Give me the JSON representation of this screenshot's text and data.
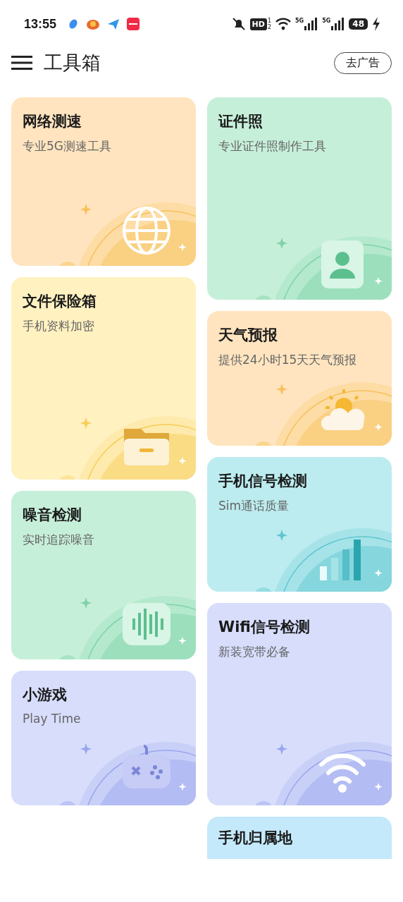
{
  "status_bar": {
    "time": "13:55",
    "hd": "HD",
    "hd_sup": "1",
    "hd_sub": "2",
    "net_1": "5G",
    "net_2": "5G",
    "battery": "48"
  },
  "header": {
    "title": "工具箱",
    "ad_button": "去广告"
  },
  "columns": [
    [
      {
        "title": "网络测速",
        "subtitle": "专业5G测速工具",
        "kind": "globe",
        "color": "#ffe4bf"
      },
      {
        "title": "文件保险箱",
        "subtitle": "手机资料加密",
        "kind": "folder",
        "color": "#fff1c0"
      },
      {
        "title": "噪音检测",
        "subtitle": "实时追踪噪音",
        "kind": "sound",
        "color": "#c6efd9"
      },
      {
        "title": "小游戏",
        "subtitle": "Play Time",
        "kind": "game",
        "color": "#d7ddfb"
      }
    ],
    [
      {
        "title": "证件照",
        "subtitle": "专业证件照制作工具",
        "kind": "person",
        "color": "#c6efd9"
      },
      {
        "title": "天气预报",
        "subtitle": "提供24小时15天天气预报",
        "kind": "weather",
        "color": "#ffe4bf"
      },
      {
        "title": "手机信号检测",
        "subtitle": "Sim通话质量",
        "kind": "signal",
        "color": "#bcecef"
      },
      {
        "title": "Wifi信号检测",
        "subtitle": "新装宽带必备",
        "kind": "wifi",
        "color": "#d7ddfb"
      },
      {
        "title": "手机归属地",
        "kind": "cut",
        "color": "#c4e9fa"
      }
    ]
  ]
}
